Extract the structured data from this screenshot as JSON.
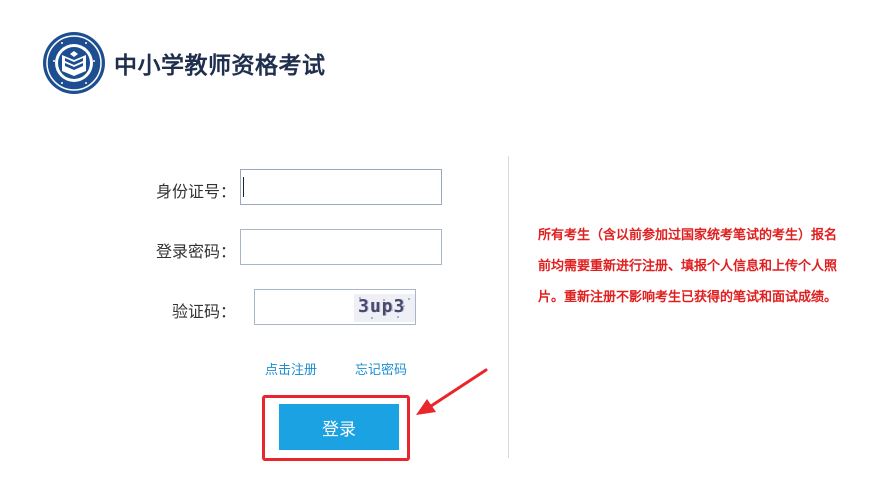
{
  "header": {
    "title": "中小学教师资格考试"
  },
  "form": {
    "id_label": "身份证号：",
    "id_value": "",
    "password_label": "登录密码：",
    "password_value": "",
    "captcha_label": "验证码：",
    "captcha_value": "",
    "captcha_image_text": "3up3",
    "register_link": "点击注册",
    "forgot_link": "忘记密码",
    "login_button": "登录"
  },
  "notice": {
    "text": "所有考生（含以前参加过国家统考笔试的考生）报名前均需要重新进行注册、填报个人信息和上传个人照片。重新注册不影响考生已获得的笔试和面试成绩。"
  },
  "colors": {
    "title": "#1f2f4d",
    "link": "#1a8ed0",
    "button": "#1ba2e2",
    "notice": "#e02020",
    "annotation": "#e8262b"
  },
  "icons": {
    "logo": "exam-emblem-logo",
    "annotation": "red-pointer-arrow-icon"
  }
}
